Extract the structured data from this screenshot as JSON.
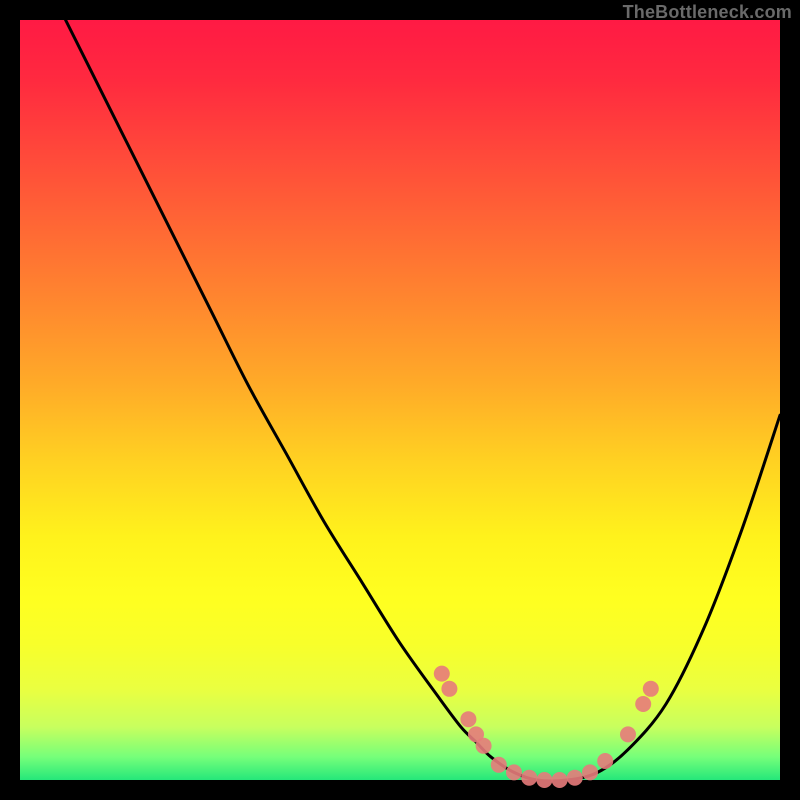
{
  "attribution": "TheBottleneck.com",
  "chart_data": {
    "type": "line",
    "title": "",
    "xlabel": "",
    "ylabel": "",
    "xlim": [
      0,
      100
    ],
    "ylim": [
      0,
      100
    ],
    "series": [
      {
        "name": "bottleneck-curve",
        "x": [
          6,
          10,
          15,
          20,
          25,
          30,
          35,
          40,
          45,
          50,
          55,
          58,
          60,
          62,
          65,
          68,
          72,
          76,
          80,
          85,
          90,
          95,
          100
        ],
        "y": [
          100,
          92,
          82,
          72,
          62,
          52,
          43,
          34,
          26,
          18,
          11,
          7,
          5,
          3,
          1,
          0,
          0,
          1,
          4,
          10,
          20,
          33,
          48
        ]
      }
    ],
    "markers": [
      {
        "x": 55.5,
        "y": 14
      },
      {
        "x": 56.5,
        "y": 12
      },
      {
        "x": 59.0,
        "y": 8
      },
      {
        "x": 60.0,
        "y": 6
      },
      {
        "x": 61.0,
        "y": 4.5
      },
      {
        "x": 63.0,
        "y": 2
      },
      {
        "x": 65.0,
        "y": 1
      },
      {
        "x": 67.0,
        "y": 0.3
      },
      {
        "x": 69.0,
        "y": 0
      },
      {
        "x": 71.0,
        "y": 0
      },
      {
        "x": 73.0,
        "y": 0.3
      },
      {
        "x": 75.0,
        "y": 1
      },
      {
        "x": 77.0,
        "y": 2.5
      },
      {
        "x": 80.0,
        "y": 6
      },
      {
        "x": 82.0,
        "y": 10
      },
      {
        "x": 83.0,
        "y": 12
      }
    ],
    "marker_color": "#e77b7b",
    "curve_color": "#000000"
  }
}
